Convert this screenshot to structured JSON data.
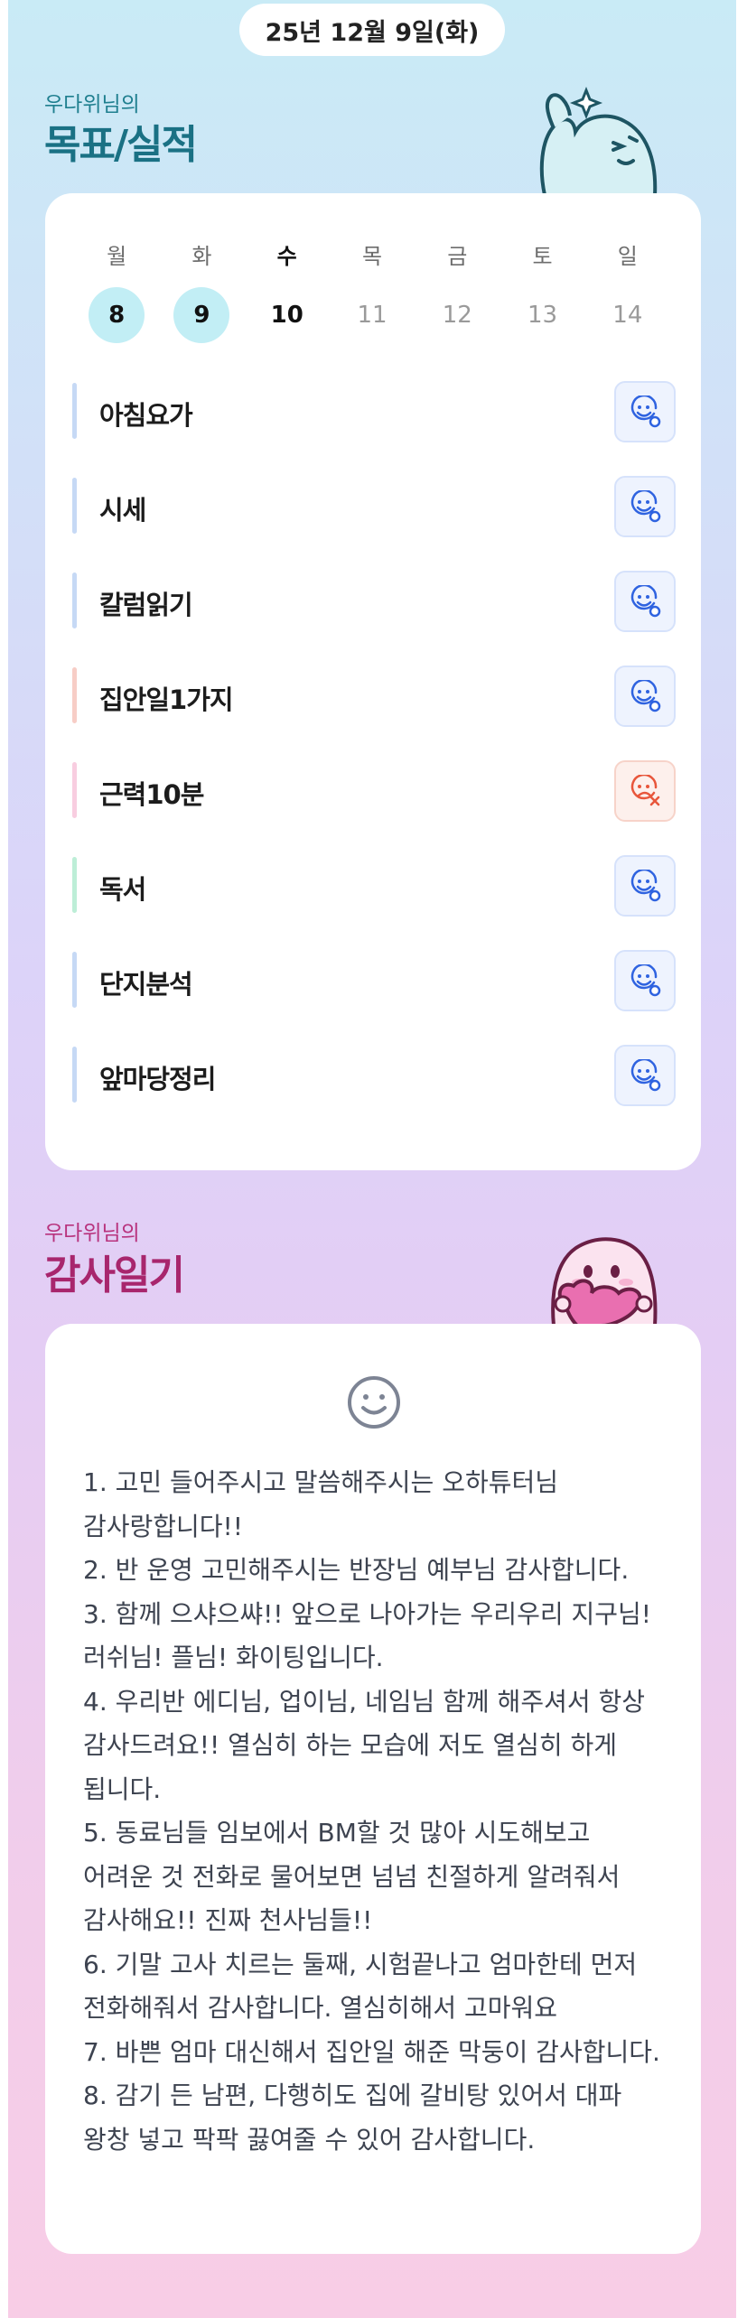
{
  "header": {
    "date": "25년 12월 9일(화)"
  },
  "goal_section": {
    "subtitle": "우다위님의",
    "title": "목표/실적",
    "week": {
      "days": [
        {
          "label": "월",
          "date": "8",
          "state": "done"
        },
        {
          "label": "화",
          "date": "9",
          "state": "done"
        },
        {
          "label": "수",
          "date": "10",
          "state": "today"
        },
        {
          "label": "목",
          "date": "11",
          "state": "future"
        },
        {
          "label": "금",
          "date": "12",
          "state": "future"
        },
        {
          "label": "토",
          "date": "13",
          "state": "future"
        },
        {
          "label": "일",
          "date": "14",
          "state": "future"
        }
      ]
    },
    "goals": [
      {
        "label": "아침요가",
        "bar_color": "#c6d9f5",
        "status": "achieved"
      },
      {
        "label": "시세",
        "bar_color": "#c6d9f5",
        "status": "achieved"
      },
      {
        "label": "칼럼읽기",
        "bar_color": "#c6d9f5",
        "status": "achieved"
      },
      {
        "label": "집안일1가지",
        "bar_color": "#f7cdc6",
        "status": "achieved"
      },
      {
        "label": "근력10분",
        "bar_color": "#f8cde0",
        "status": "missed"
      },
      {
        "label": "독서",
        "bar_color": "#bdeed7",
        "status": "achieved"
      },
      {
        "label": "단지분석",
        "bar_color": "#c6d9f5",
        "status": "achieved"
      },
      {
        "label": "앞마당정리",
        "bar_color": "#c6d9f5",
        "status": "achieved"
      }
    ],
    "status_icons": {
      "achieved": "smile-check-icon",
      "missed": "sad-x-icon"
    },
    "colors": {
      "achieved_fg": "#2f63e0",
      "achieved_bg": "#eef3fe",
      "missed_fg": "#e8563b",
      "missed_bg": "#fdf0ec"
    }
  },
  "gratitude_section": {
    "subtitle": "우다위님의",
    "title": "감사일기",
    "mood_icon": "smile-face-icon",
    "lines": [
      "1. 고민 들어주시고 말씀해주시는 오하튜터님 감사랑합니다!!",
      "2. 반 운영 고민해주시는 반장님 예부님 감사합니다.",
      "3. 함께 으샤으쌰!! 앞으로 나아가는 우리우리 지구님! 러쉬님! 플님! 화이팅입니다.",
      "4. 우리반 에디님, 업이님, 네임님 함께 해주셔서 항상 감사드려요!! 열심히 하는 모습에 저도 열심히 하게 됩니다.",
      "5. 동료님들 임보에서 BM할 것 많아 시도해보고 어려운 것 전화로 물어보면 넘넘 친절하게 알려줘서 감사해요!! 진짜 천사님들!!",
      "6. 기말 고사 치르는 둘째, 시험끝나고 엄마한테 먼저 전화해줘서 감사합니다. 열심히해서 고마워요",
      "7. 바쁜 엄마 대신해서 집안일 해준 막둥이 감사합니다.",
      "8. 감기 든 남편, 다행히도 집에 갈비탕 있어서 대파 왕창 넣고 팍팍 끓여줄 수 있어 감사합니다."
    ]
  }
}
